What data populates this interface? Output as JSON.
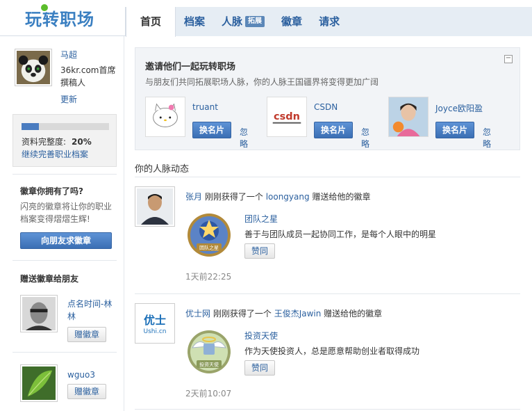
{
  "app": {
    "logo_text": "玩转职场"
  },
  "nav": {
    "items": [
      "首页",
      "档案",
      "人脉",
      "徽章",
      "请求"
    ],
    "tag": "拓展"
  },
  "sidebar": {
    "profile": {
      "name": "马超",
      "bio": "36kr.com首席撰稿人",
      "update": "更新"
    },
    "progress": {
      "label": "资料完整度:",
      "value": "20%",
      "fraction": 0.2,
      "link": "继续完善职业档案"
    },
    "badge_promo": {
      "title": "徽章你拥有了吗?",
      "desc": "闪亮的徽章将让你的职业档案变得熠熠生辉!",
      "button": "向朋友求徽章"
    },
    "gift": {
      "title": "赠送徽章给朋友",
      "friends": [
        {
          "name": "点名时间-林林",
          "button": "赠徽章"
        },
        {
          "name": "wguo3",
          "button": "赠徽章"
        }
      ]
    }
  },
  "invite": {
    "title": "邀请他们一起玩转职场",
    "subtitle": "与朋友们共同拓展职场人脉，你的人脉王国疆界将变得更加广阔",
    "close": "−",
    "suggestions": [
      {
        "name": "truant",
        "button": "换名片",
        "ignore": "忽略"
      },
      {
        "name": "CSDN",
        "button": "换名片",
        "ignore": "忽略",
        "logo": "csdn"
      },
      {
        "name": "Joyce欧阳盈",
        "button": "换名片",
        "ignore": "忽略"
      }
    ]
  },
  "feed": {
    "title": "你的人脉动态",
    "items": [
      {
        "actor": "张月",
        "verb": "刚刚获得了一个",
        "giver": "loongyang",
        "suffix": "赠送给他的徽章",
        "badge_name": "团队之星",
        "badge_desc": "善于与团队成员一起协同工作，是每个人眼中的明星",
        "badge_label": "团队之星",
        "like": "赞同",
        "time": "1天前22:25"
      },
      {
        "actor": "优士网",
        "verb": "刚刚获得了一个",
        "giver": "王俊杰Jawin",
        "suffix": "赠送给他的徽章",
        "badge_name": "投资天使",
        "badge_desc": "作为天使投资人，总是愿意帮助创业者取得成功",
        "badge_label": "投资天使",
        "like": "赞同",
        "time": "2天前10:07",
        "logo_cn": "优士",
        "logo_en": "Ushi.cn"
      }
    ]
  },
  "colors": {
    "brand": "#3a7fc1",
    "nav_bg": "#e6edf4",
    "button_blue": "#4a7cc0",
    "link": "#2a5f9e"
  }
}
